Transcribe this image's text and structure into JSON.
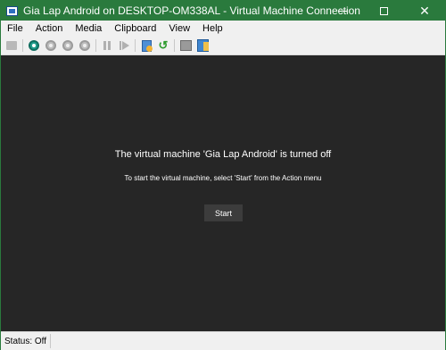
{
  "window": {
    "title": "Gia Lap Android on DESKTOP-OM338AL - Virtual Machine Connection",
    "accent_color": "#2a7a3d",
    "controls": {
      "minimize": "minimize-icon",
      "maximize": "maximize-icon",
      "close": "✕"
    }
  },
  "menu": {
    "items": [
      "File",
      "Action",
      "Media",
      "Clipboard",
      "View",
      "Help"
    ]
  },
  "toolbar": {
    "icons": [
      "ctrl-alt-del-icon",
      "start-icon",
      "turn-off-icon",
      "shut-down-icon",
      "save-icon",
      "pause-icon",
      "resume-icon",
      "checkpoint-icon",
      "revert-icon",
      "share-icon",
      "enhanced-session-icon"
    ]
  },
  "display": {
    "background": "#262626",
    "message_title": "The virtual machine 'Gia Lap Android' is turned off",
    "message_sub": "To start the virtual machine, select 'Start' from the Action menu",
    "start_button": "Start"
  },
  "status": {
    "text": "Status: Off"
  }
}
